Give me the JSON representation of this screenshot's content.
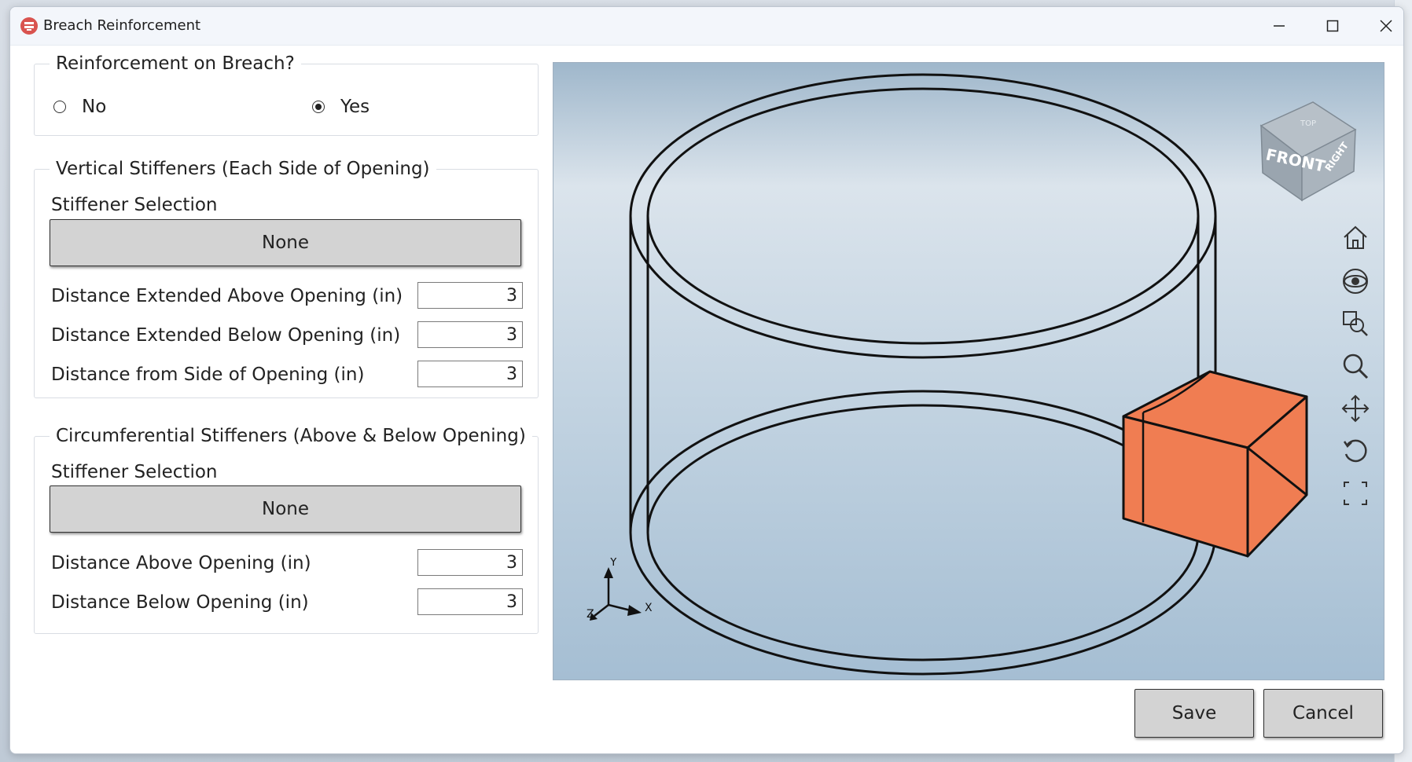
{
  "window": {
    "title": "Breach Reinforcement",
    "minimize_icon": "minimize-icon",
    "maximize_icon": "maximize-icon",
    "close_icon": "close-icon"
  },
  "breach_group": {
    "title": "Reinforcement on Breach?",
    "options": [
      {
        "label": "No",
        "selected": false
      },
      {
        "label": "Yes",
        "selected": true
      }
    ]
  },
  "vertical_group": {
    "title": "Vertical Stiffeners (Each Side of Opening)",
    "selection_label": "Stiffener Selection",
    "selection_value": "None",
    "fields": [
      {
        "label": "Distance Extended Above Opening (in)",
        "value": "3"
      },
      {
        "label": "Distance Extended Below Opening (in)",
        "value": "3"
      },
      {
        "label": "Distance from Side of Opening (in)",
        "value": "3"
      }
    ]
  },
  "circumferential_group": {
    "title": "Circumferential Stiffeners (Above & Below Opening)",
    "selection_label": "Stiffener Selection",
    "selection_value": "None",
    "fields": [
      {
        "label": "Distance Above Opening (in)",
        "value": "3"
      },
      {
        "label": "Distance Below Opening (in)",
        "value": "3"
      }
    ]
  },
  "viewer": {
    "view_cube": {
      "front": "FRONT",
      "right": "RIGHT",
      "top": "TOP"
    },
    "axes": {
      "x": "X",
      "y": "Y",
      "z": "Z"
    },
    "nav_icons": [
      "home-icon",
      "orbit-icon",
      "zoom-window-icon",
      "zoom-icon",
      "pan-icon",
      "rotate-icon",
      "fit-view-icon"
    ],
    "opening_color": "#f07d52"
  },
  "actions": {
    "save": "Save",
    "cancel": "Cancel"
  }
}
